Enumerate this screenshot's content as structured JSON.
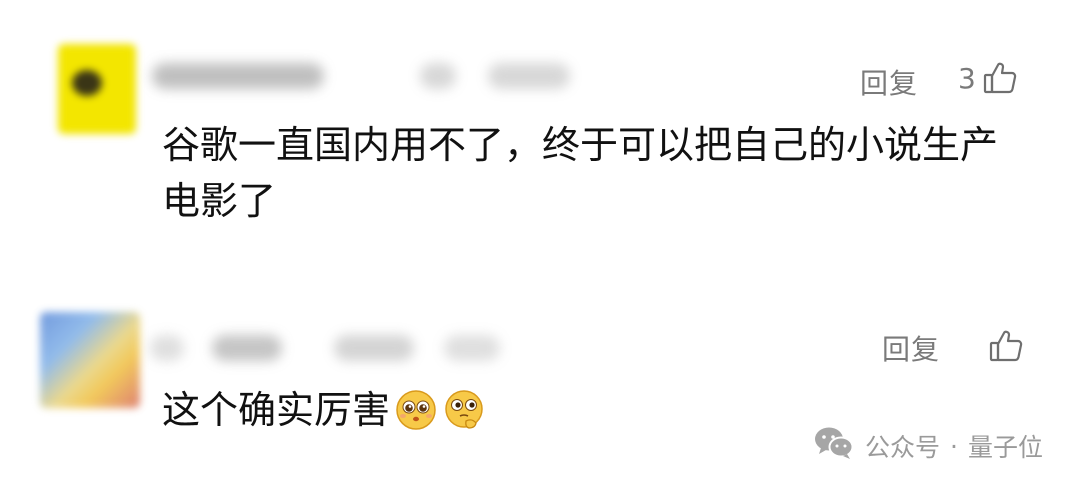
{
  "comments": [
    {
      "reply_label": "回复",
      "like_count": "3",
      "text": "谷歌一直国内用不了，终于可以把自己的小说生产电影了",
      "avatar_color": "#f3e600"
    },
    {
      "reply_label": "回复",
      "like_count": "",
      "text": "这个确实厉害",
      "emojis": [
        "pleading-face-emoji",
        "thinking-face-emoji"
      ]
    }
  ],
  "watermark": {
    "platform": "公众号",
    "separator": "·",
    "account": "量子位"
  },
  "colors": {
    "secondary_text": "#7a7a7a",
    "body_text": "#111111",
    "watermark": "#9a9a9a"
  }
}
